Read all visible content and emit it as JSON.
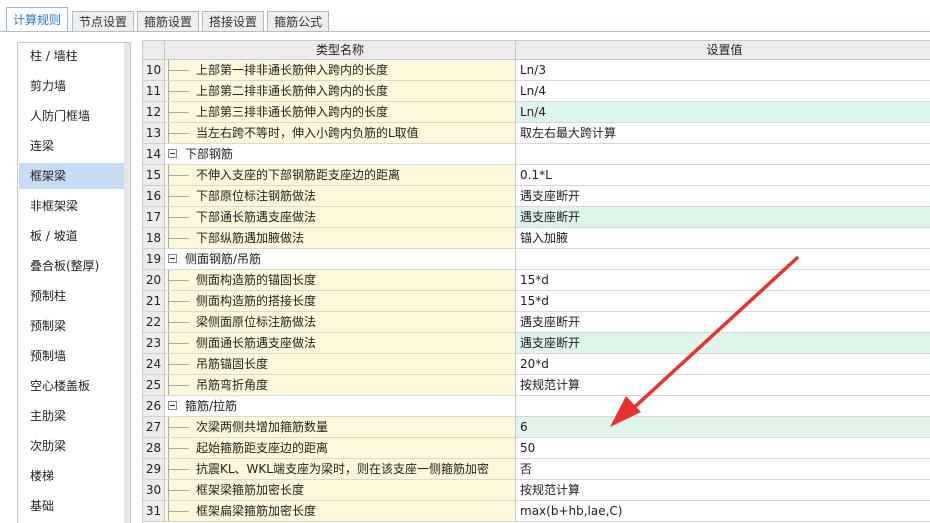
{
  "tabs": [
    {
      "label": "计算规则",
      "active": true
    },
    {
      "label": "节点设置",
      "active": false
    },
    {
      "label": "箍筋设置",
      "active": false
    },
    {
      "label": "搭接设置",
      "active": false
    },
    {
      "label": "箍筋公式",
      "active": false
    }
  ],
  "sidebar": {
    "items": [
      {
        "label": "柱 / 墙柱",
        "selected": false
      },
      {
        "label": "剪力墙",
        "selected": false
      },
      {
        "label": "人防门框墙",
        "selected": false
      },
      {
        "label": "连梁",
        "selected": false
      },
      {
        "label": "框架梁",
        "selected": true
      },
      {
        "label": "非框架梁",
        "selected": false
      },
      {
        "label": "板 / 坡道",
        "selected": false
      },
      {
        "label": "叠合板(整厚)",
        "selected": false
      },
      {
        "label": "预制柱",
        "selected": false
      },
      {
        "label": "预制梁",
        "selected": false
      },
      {
        "label": "预制墙",
        "selected": false
      },
      {
        "label": "空心楼盖板",
        "selected": false
      },
      {
        "label": "主肋梁",
        "selected": false
      },
      {
        "label": "次肋梁",
        "selected": false
      },
      {
        "label": "楼梯",
        "selected": false
      },
      {
        "label": "基础",
        "selected": false
      }
    ]
  },
  "grid": {
    "col_name": "类型名称",
    "col_value": "设置值",
    "rows": [
      {
        "num": "10",
        "name": "上部第一排非通长筋伸入跨内的长度",
        "value": "Ln/3",
        "group": false,
        "highlight": false
      },
      {
        "num": "11",
        "name": "上部第二排非通长筋伸入跨内的长度",
        "value": "Ln/4",
        "group": false,
        "highlight": false
      },
      {
        "num": "12",
        "name": "上部第三排非通长筋伸入跨内的长度",
        "value": "Ln/4",
        "group": false,
        "highlight": true
      },
      {
        "num": "13",
        "name": "当左右跨不等时，伸入小跨内负筋的L取值",
        "value": "取左右最大跨计算",
        "group": false,
        "highlight": false
      },
      {
        "num": "14",
        "name": "下部钢筋",
        "value": "",
        "group": true,
        "highlight": false
      },
      {
        "num": "15",
        "name": "不伸入支座的下部钢筋距支座边的距离",
        "value": "0.1*L",
        "group": false,
        "highlight": false
      },
      {
        "num": "16",
        "name": "下部原位标注钢筋做法",
        "value": "遇支座断开",
        "group": false,
        "highlight": false
      },
      {
        "num": "17",
        "name": "下部通长筋遇支座做法",
        "value": "遇支座断开",
        "group": false,
        "highlight": true
      },
      {
        "num": "18",
        "name": "下部纵筋遇加腋做法",
        "value": "锚入加腋",
        "group": false,
        "highlight": false
      },
      {
        "num": "19",
        "name": "侧面钢筋/吊筋",
        "value": "",
        "group": true,
        "highlight": false
      },
      {
        "num": "20",
        "name": "侧面构造筋的锚固长度",
        "value": "15*d",
        "group": false,
        "highlight": false
      },
      {
        "num": "21",
        "name": "侧面构造筋的搭接长度",
        "value": "15*d",
        "group": false,
        "highlight": false
      },
      {
        "num": "22",
        "name": "梁侧面原位标注筋做法",
        "value": "遇支座断开",
        "group": false,
        "highlight": false
      },
      {
        "num": "23",
        "name": "侧面通长筋遇支座做法",
        "value": "遇支座断开",
        "group": false,
        "highlight": true
      },
      {
        "num": "24",
        "name": "吊筋锚固长度",
        "value": "20*d",
        "group": false,
        "highlight": false
      },
      {
        "num": "25",
        "name": "吊筋弯折角度",
        "value": "按规范计算",
        "group": false,
        "highlight": false
      },
      {
        "num": "26",
        "name": "箍筋/拉筋",
        "value": "",
        "group": true,
        "highlight": false
      },
      {
        "num": "27",
        "name": "次梁两侧共增加箍筋数量",
        "value": "6",
        "group": false,
        "highlight": true
      },
      {
        "num": "28",
        "name": "起始箍筋距支座边的距离",
        "value": "50",
        "group": false,
        "highlight": false
      },
      {
        "num": "29",
        "name": "抗震KL、WKL端支座为梁时，则在该支座一侧箍筋加密",
        "value": "否",
        "group": false,
        "highlight": false
      },
      {
        "num": "30",
        "name": "框架梁箍筋加密长度",
        "value": "按规范计算",
        "group": false,
        "highlight": false
      },
      {
        "num": "31",
        "name": "框架扁梁箍筋加密长度",
        "value": "max(b+hb,lae,C)",
        "group": false,
        "highlight": false
      }
    ]
  },
  "annotation": {
    "color": "#e8322e"
  }
}
